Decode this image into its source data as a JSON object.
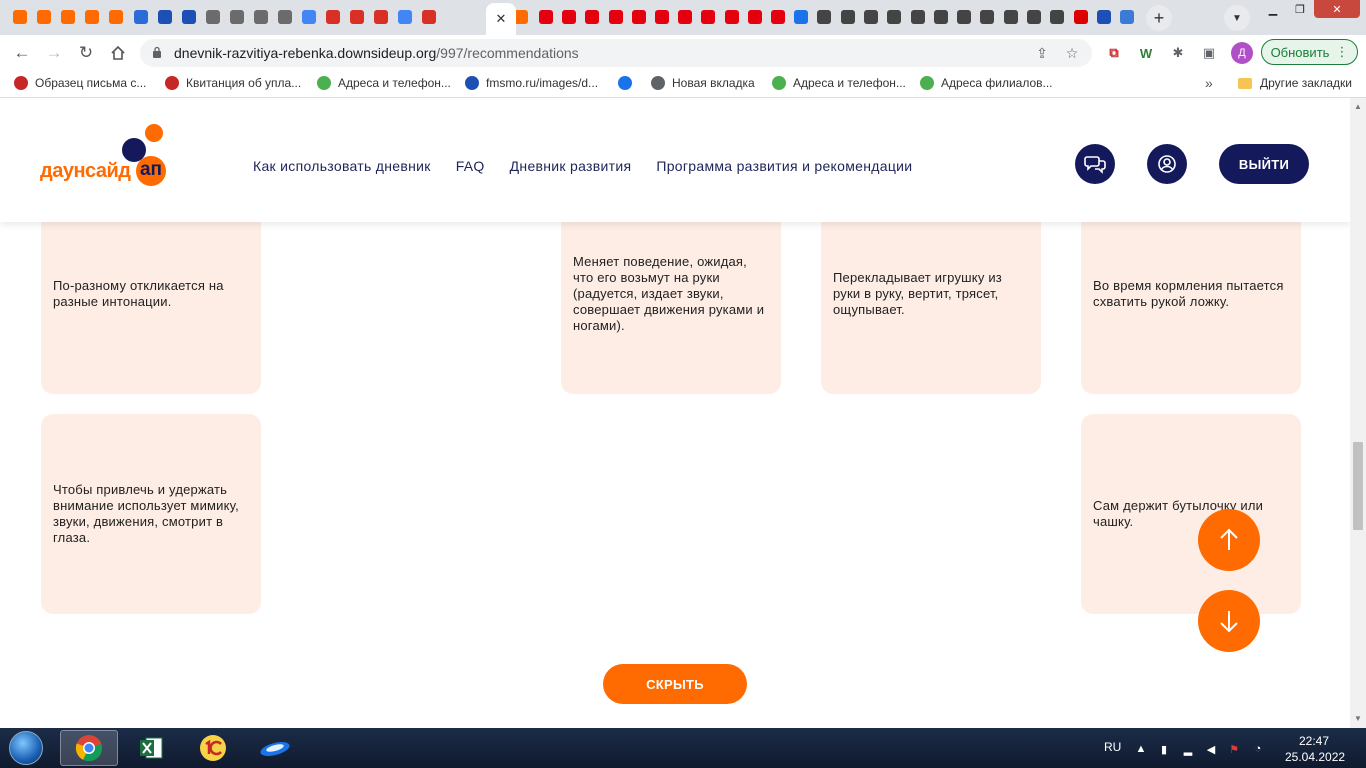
{
  "browser": {
    "url_domain": "dnevnik-razvitiya-rebenka.downsideup.org",
    "url_path": "/997/recommendations",
    "update_label": "Обновить",
    "profile_initial": "Д",
    "active_tab_close": "✕",
    "tabs": [
      {
        "icon": "downsideup-favicon",
        "color": "#ff6b00"
      },
      {
        "icon": "downsideup-favicon",
        "color": "#ff6b00"
      },
      {
        "icon": "downsideup-favicon",
        "color": "#ff6b00"
      },
      {
        "icon": "downsideup-favicon",
        "color": "#ff6b00"
      },
      {
        "icon": "downsideup-favicon",
        "color": "#ff6b00"
      },
      {
        "icon": "mail-at-favicon",
        "color": "#2b6cd9"
      },
      {
        "icon": "mail-envelope-favicon",
        "color": "#1e4fb5"
      },
      {
        "icon": "mail-envelope-favicon",
        "color": "#1e4fb5"
      },
      {
        "icon": "globe-favicon",
        "color": "#6b6b6b"
      },
      {
        "icon": "globe-favicon",
        "color": "#6b6b6b"
      },
      {
        "icon": "globe-favicon",
        "color": "#6b6b6b"
      },
      {
        "icon": "globe-favicon",
        "color": "#6b6b6b"
      },
      {
        "icon": "google-favicon",
        "color": "#4285f4"
      },
      {
        "icon": "triangle-favicon",
        "color": "#d93025"
      },
      {
        "icon": "basket-favicon",
        "color": "#d93025"
      },
      {
        "icon": "basket-favicon",
        "color": "#d93025"
      },
      {
        "icon": "google-favicon",
        "color": "#4285f4"
      },
      {
        "icon": "basket-favicon",
        "color": "#d93025"
      },
      {
        "icon": "downsideup-favicon",
        "color": "#ff6b00"
      },
      {
        "icon": "hm-favicon",
        "color": "#e50010"
      },
      {
        "icon": "hm-favicon",
        "color": "#e50010"
      },
      {
        "icon": "hm-favicon",
        "color": "#e50010"
      },
      {
        "icon": "hm-favicon",
        "color": "#e50010"
      },
      {
        "icon": "hm-favicon",
        "color": "#e50010"
      },
      {
        "icon": "hm-favicon",
        "color": "#e50010"
      },
      {
        "icon": "hm-favicon",
        "color": "#e50010"
      },
      {
        "icon": "hm-favicon",
        "color": "#e50010"
      },
      {
        "icon": "hm-favicon",
        "color": "#e50010"
      },
      {
        "icon": "hm-favicon",
        "color": "#e50010"
      },
      {
        "icon": "hm-favicon",
        "color": "#e50010"
      },
      {
        "icon": "lines-favicon",
        "color": "#1a73e8"
      },
      {
        "icon": "zara-favicon",
        "color": "#444444"
      },
      {
        "icon": "zara-favicon",
        "color": "#444444"
      },
      {
        "icon": "zara-favicon",
        "color": "#444444"
      },
      {
        "icon": "zara-favicon",
        "color": "#444444"
      },
      {
        "icon": "zara-favicon",
        "color": "#444444"
      },
      {
        "icon": "zara-favicon",
        "color": "#444444"
      },
      {
        "icon": "zara-favicon",
        "color": "#444444"
      },
      {
        "icon": "zara-favicon",
        "color": "#444444"
      },
      {
        "icon": "zara-favicon",
        "color": "#444444"
      },
      {
        "icon": "zara-favicon",
        "color": "#444444"
      },
      {
        "icon": "zara-favicon",
        "color": "#444444"
      },
      {
        "icon": "flag-favicon",
        "color": "#dd0000"
      },
      {
        "icon": "news-favicon",
        "color": "#1e4fb5"
      },
      {
        "icon": "wiki-favicon",
        "color": "#3a7bd5"
      }
    ],
    "bookmarks": [
      {
        "label": "Образец письма с...",
        "icon": "bookmark-service-icon",
        "color": "#c62828"
      },
      {
        "label": "Квитанция об упла...",
        "icon": "bookmark-gear-icon",
        "color": "#c62828"
      },
      {
        "label": "Адреса и телефон...",
        "icon": "bookmark-link-icon",
        "color": "#4caf50"
      },
      {
        "label": "fmsmo.ru/images/d...",
        "icon": "bookmark-globe-icon",
        "color": "#1e4fb5"
      },
      {
        "label": "",
        "icon": "bookmark-check-icon",
        "color": "#1a73e8"
      },
      {
        "label": "Новая вкладка",
        "icon": "bookmark-globe-icon",
        "color": "#5f6368"
      },
      {
        "label": "Адреса и телефон...",
        "icon": "bookmark-link-icon",
        "color": "#4caf50"
      },
      {
        "label": "Адреса филиалов...",
        "icon": "bookmark-link-icon",
        "color": "#4caf50"
      }
    ],
    "bookmarks_more": "»",
    "other_bookmarks": "Другие закладки"
  },
  "site": {
    "logo_text": "даунсайд",
    "logo_ap": "ап",
    "nav": [
      "Как использовать дневник",
      "FAQ",
      "Дневник развития",
      "Программа развития и рекомендации"
    ],
    "logout_label": "ВЫЙТИ",
    "brand_orange": "#ff6b00",
    "brand_navy": "#14195c",
    "card_bg": "#fdede4"
  },
  "cards_row1": [
    "По-разному откликается на разные интонации.",
    "Меняет поведение, ожидая, что его возьмут на руки (радуется, издает звуки, совершает движения руками и ногами).",
    "Перекладывает игрушку из руки в руку, вертит, трясет, ощупывает.",
    "Во время кормления пытается схватить рукой ложку."
  ],
  "cards_row2": [
    "Чтобы привлечь и удержать внимание использует мимику, звуки, движения, смотрит в глаза.",
    "Сам держит бутылочку или чашку."
  ],
  "hide_label": "СКРЫТЬ",
  "taskbar": {
    "lang": "RU",
    "time": "22:47",
    "date": "25.04.2022"
  }
}
